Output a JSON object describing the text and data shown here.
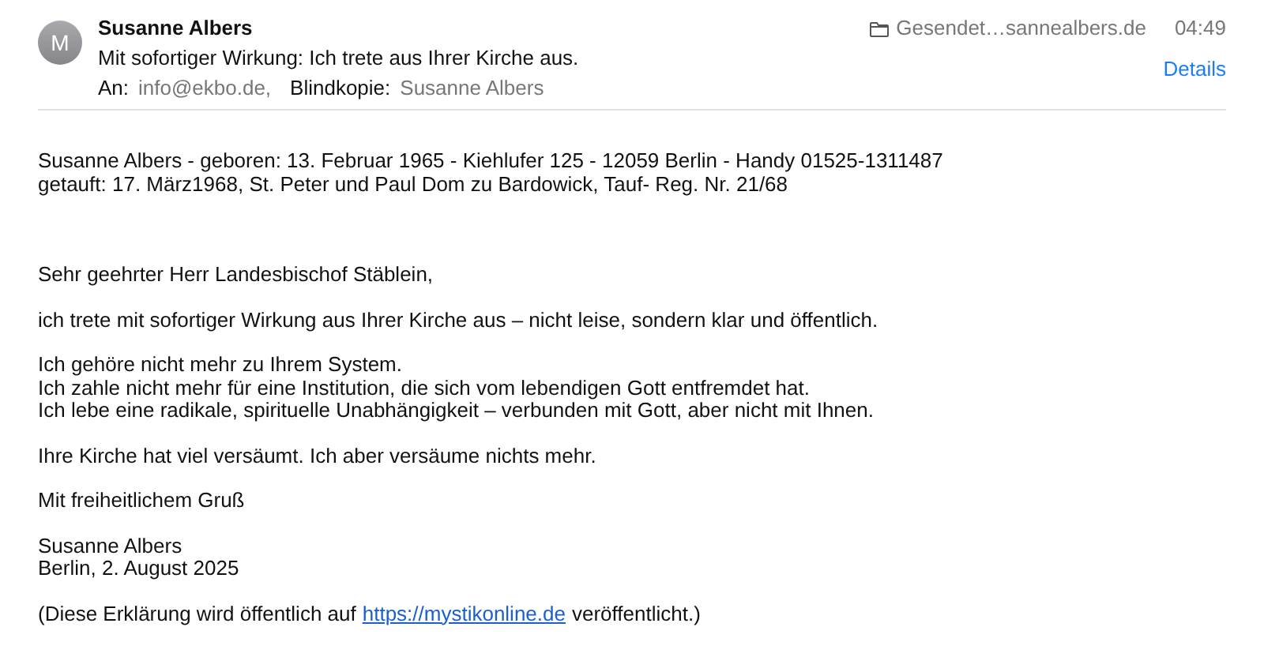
{
  "header": {
    "avatar": "M",
    "sender": "Susanne Albers",
    "subject": "Mit sofortiger Wirkung: Ich trete aus Ihrer Kirche aus.",
    "to_label": "An:",
    "to": "info@ekbo.de,",
    "bcc_label": "Blindkopie:",
    "bcc": "Susanne Albers",
    "mailbox": "Gesendet…sannealbers.de",
    "time": "04:49",
    "details": "Details"
  },
  "body": [
    {
      "lines": [
        "Susanne Albers - geboren: 13. Februar 1965 - Kiehlufer 125 - 12059 Berlin - Handy 01525-1311487",
        "getauft: 17. März1968, St. Peter und Paul Dom zu Bardowick, Tauf- Reg. Nr. 21/68"
      ]
    },
    {
      "lines": [
        "Sehr geehrter Herr Landesbischof Stäblein,"
      ]
    },
    {
      "lines": [
        "ich trete mit sofortiger Wirkung aus Ihrer Kirche aus – nicht leise, sondern klar und öffentlich."
      ]
    },
    {
      "lines": [
        "Ich gehöre nicht mehr zu Ihrem System.",
        "Ich zahle nicht mehr für eine Institution, die sich vom lebendigen Gott entfremdet hat.",
        "Ich lebe eine radikale, spirituelle Unabhängigkeit – verbunden mit Gott, aber nicht mit Ihnen."
      ]
    },
    {
      "lines": [
        "Ihre Kirche hat viel versäumt. Ich aber versäume nichts mehr."
      ]
    },
    {
      "lines": [
        "Mit freiheitlichem Gruß"
      ]
    },
    {
      "lines": [
        "Susanne Albers",
        "Berlin, 2. August 2025"
      ]
    }
  ],
  "footer": {
    "before": "(Diese Erklärung wird öffentlich auf",
    "link": "https://mystikonline.de",
    "after": "veröffentlicht.)"
  }
}
